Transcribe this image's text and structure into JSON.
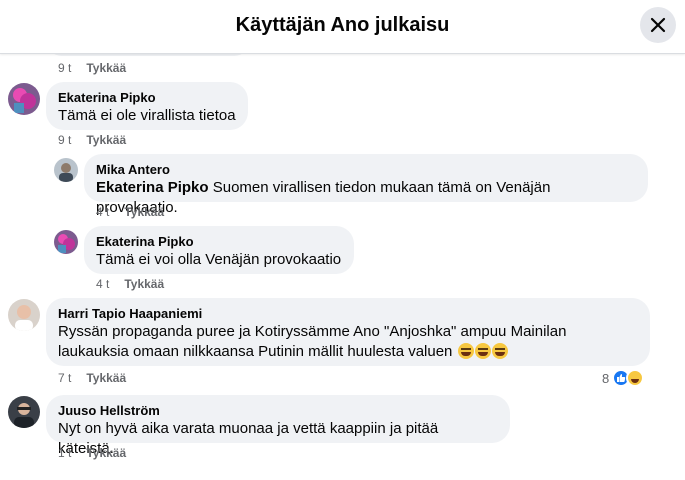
{
  "header": {
    "title": "Käyttäjän Ano julkaisu"
  },
  "top_meta": {
    "time": "9 t",
    "like_label": "Tykkää"
  },
  "comments": [
    {
      "author": "Ekaterina Pipko",
      "text": "Tämä ei ole virallista tietoa",
      "time": "9 t",
      "like_label": "Tykkää"
    },
    {
      "author": "Mika Antero",
      "mention": "Ekaterina Pipko",
      "text": "Suomen virallisen tiedon mukaan tämä on Venäjän provokaatio.",
      "time": "4 t",
      "like_label": "Tykkää"
    },
    {
      "author": "Ekaterina Pipko",
      "text": "Tämä ei voi olla Venäjän provokaatio",
      "time": "4 t",
      "like_label": "Tykkää"
    },
    {
      "author": "Harri Tapio Haapaniemi",
      "text_line1": "Ryssän propaganda puree ja Kotiryssämme Ano \"Anjoshka\" ampuu Mainilan",
      "text_line2": "laukauksia omaan nilkkaansa Putinin mällit huulesta valuen",
      "emojis": [
        "laughing-emoji",
        "grinning-emoji",
        "rolling-laughing-emoji"
      ],
      "time": "7 t",
      "like_label": "Tykkää",
      "reaction_count": "8",
      "reaction_icons": [
        "like-reaction-icon",
        "haha-reaction-icon"
      ]
    },
    {
      "author": "Juuso Hellström",
      "text": "Nyt on hyvä aika varata muonaa ja vettä kaappiin ja pitää käteistä.",
      "time": "1 t",
      "like_label": "Tykkää"
    }
  ],
  "colors": {
    "bubble": "#f0f2f5",
    "meta_text": "#65676b",
    "like_blue": "#1877f2",
    "close_button_bg": "#e4e6eb"
  }
}
